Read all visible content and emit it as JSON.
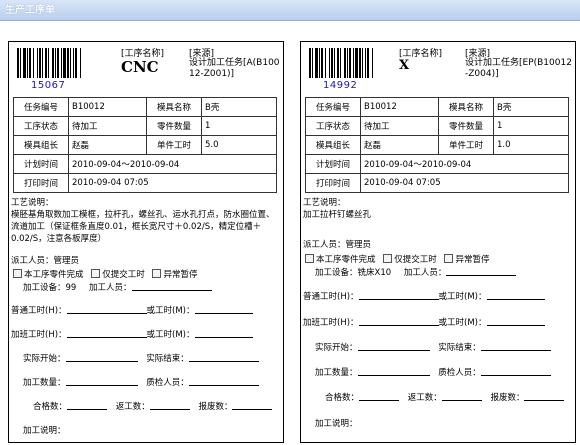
{
  "window": {
    "title": "生产工序单"
  },
  "cards": [
    {
      "barcode_number": "15067",
      "process_label": "[工序名称]",
      "process_name": "CNC",
      "source_label": "[来源]",
      "source_value": "设计加工任务[A(B10012-Z001)]",
      "fields": {
        "task_no_label": "任务编号",
        "task_no": "B10012",
        "mold_name_label": "模具名称",
        "mold_name": "B壳",
        "status_label": "工序状态",
        "status": "待加工",
        "part_count_label": "零件数量",
        "part_count": "1",
        "leader_label": "模具组长",
        "leader": "赵磊",
        "unit_time_label": "单件工时",
        "unit_time": "5.0",
        "plan_time_label": "计划时间",
        "plan_time": "2010-09-04～2010-09-04",
        "print_time_label": "打印时间",
        "print_time": "2010-09-04 07:05"
      },
      "craft_label": "工艺说明：",
      "craft_text": "模胚基角取数加工模框，拉杆孔，螺丝孔、运水孔打点，防水圈位置、流道加工（保证框条直度0.01，框长宽尺寸＋0.02/S，精定位槽＋0.02/S，注意各板厚度）",
      "dispatcher_label": "派工人员：",
      "dispatcher": "管理员",
      "checkbox_1": "本工序零件完成",
      "checkbox_2": "仅提交工时",
      "checkbox_3": "异常暂停",
      "equipment_label": "加工设备：",
      "equipment": "99",
      "worker_label": "加工人员：",
      "normal_hours_label": "普通工时(H)：",
      "or_hours_label": "或工时(M)：",
      "overtime_hours_label": "加班工时(H)：",
      "actual_start_label": "实际开始：",
      "actual_end_label": "实际结束：",
      "process_qty_label": "加工数量：",
      "inspector_label": "质检人员：",
      "pass_qty_label": "合格数：",
      "rework_qty_label": "返工数：",
      "scrap_qty_label": "报废数：",
      "process_note_label": "加工说明："
    },
    {
      "barcode_number": "14992",
      "process_label": "[工序名称]",
      "process_name": "X",
      "source_label": "[来源]",
      "source_value": "设计加工任务[EP(B10012-Z004)]",
      "fields": {
        "task_no_label": "任务编号",
        "task_no": "B10012",
        "mold_name_label": "模具名称",
        "mold_name": "B壳",
        "status_label": "工序状态",
        "status": "待加工",
        "part_count_label": "零件数量",
        "part_count": "1",
        "leader_label": "模具组长",
        "leader": "赵磊",
        "unit_time_label": "单件工时",
        "unit_time": "1.0",
        "plan_time_label": "计划时间",
        "plan_time": "2010-09-04～2010-09-04",
        "print_time_label": "打印时间",
        "print_time": "2010-09-04 07:05"
      },
      "craft_label": "工艺说明：",
      "craft_text": "加工拉杆钉螺丝孔",
      "dispatcher_label": "派工人员：",
      "dispatcher": "管理员",
      "checkbox_1": "本工序零件完成",
      "checkbox_2": "仅提交工时",
      "checkbox_3": "异常暂停",
      "equipment_label": "加工设备：",
      "equipment": "铣床X10",
      "worker_label": "加工人员：",
      "normal_hours_label": "普通工时(H)：",
      "or_hours_label": "或工时(M)：",
      "overtime_hours_label": "加班工时(H)：",
      "actual_start_label": "实际开始：",
      "actual_end_label": "实际结束：",
      "process_qty_label": "加工数量：",
      "inspector_label": "质检人员：",
      "pass_qty_label": "合格数：",
      "rework_qty_label": "返工数：",
      "scrap_qty_label": "报废数：",
      "process_note_label": "加工说明："
    }
  ]
}
